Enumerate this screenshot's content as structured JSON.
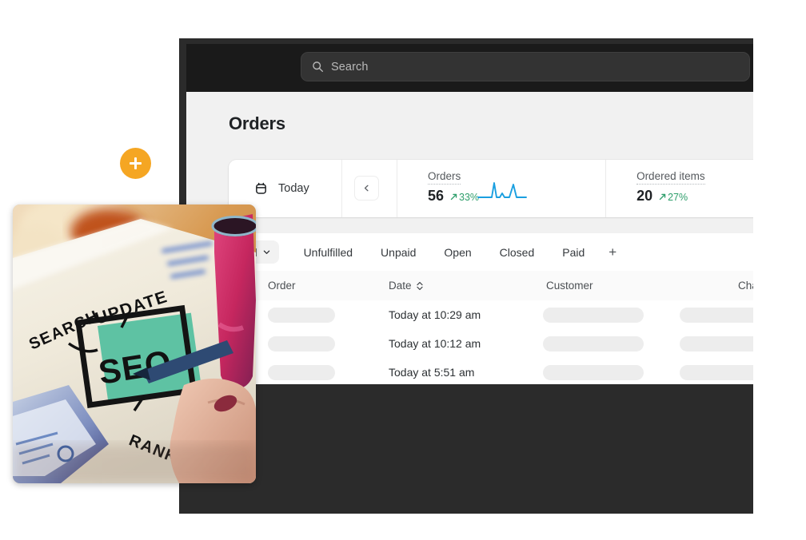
{
  "window": {
    "frame_color": "#2b2b2b",
    "topbar_color": "#1a1a1a"
  },
  "topbar": {
    "search": {
      "placeholder": "Search",
      "value": "",
      "icon": "search-icon"
    }
  },
  "page": {
    "title": "Orders"
  },
  "stats_card": {
    "date_range": {
      "icon": "calendar-icon",
      "label": "Today"
    },
    "prev_button": {
      "icon": "chevron-left-icon",
      "label": ""
    },
    "metrics": [
      {
        "label": "Orders",
        "value": "56",
        "delta": "33%",
        "delta_direction": "up",
        "delta_color": "#2e9e6b",
        "has_sparkline": true
      },
      {
        "label": "Ordered items",
        "value": "20",
        "delta": "27%",
        "delta_direction": "up",
        "delta_color": "#2e9e6b",
        "has_sparkline": false
      }
    ]
  },
  "tabs": {
    "selected": "All",
    "selected_icon": "chevron-down-icon",
    "items": [
      "Unfulfilled",
      "Unpaid",
      "Open",
      "Closed",
      "Paid"
    ],
    "add_label": "+"
  },
  "table": {
    "columns": [
      {
        "label": "Order",
        "sortable": false
      },
      {
        "label": "Date",
        "sortable": true,
        "sort_icon": "sort-arrows-icon"
      },
      {
        "label": "Customer",
        "sortable": false
      },
      {
        "label": "Chan",
        "sortable": false
      }
    ],
    "rows": [
      {
        "order": "",
        "date": "Today at 10:29 am",
        "customer": "",
        "channel": ""
      },
      {
        "order": "",
        "date": "Today at 10:12 am",
        "customer": "",
        "channel": ""
      },
      {
        "order": "",
        "date": "Today at 5:51 am",
        "customer": "",
        "channel": ""
      }
    ]
  },
  "fab": {
    "icon": "plus-icon",
    "label": "",
    "color": "#F5A623"
  },
  "photo": {
    "alt": "seo-notebook-photo",
    "handwritten_words": [
      "SEARCH",
      "UPDATE",
      "SEO",
      "RANKINGS"
    ],
    "highlight_color": "#5ec2a3"
  },
  "chart_data": {
    "type": "line",
    "title": "Orders sparkline",
    "x": [
      0,
      1,
      2,
      3,
      4,
      5,
      6,
      7,
      8,
      9,
      10,
      11
    ],
    "values": [
      0,
      0,
      0,
      0,
      10,
      0,
      1,
      0,
      6,
      0,
      0,
      0
    ],
    "xlabel": "",
    "ylabel": "",
    "ylim": [
      0,
      10
    ],
    "grid": false,
    "legend": "none",
    "color": "#1a9fe0"
  }
}
